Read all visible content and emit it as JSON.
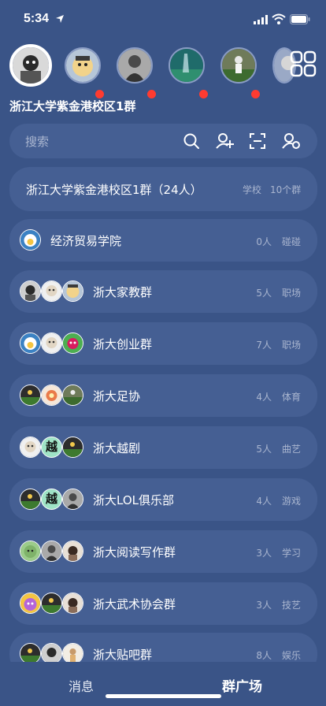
{
  "status": {
    "time": "5:34"
  },
  "group_name": "浙江大学紫金港校区1群",
  "search": {
    "placeholder": "搜索"
  },
  "hero": {
    "title": "浙江大学紫金港校区1群（24人）",
    "tag1": "学校",
    "tag2": "10个群"
  },
  "groups": [
    {
      "name": "经济贸易学院",
      "count": "0人",
      "category": "碰碰"
    },
    {
      "name": "浙大家教群",
      "count": "5人",
      "category": "职场"
    },
    {
      "name": "浙大创业群",
      "count": "7人",
      "category": "职场"
    },
    {
      "name": "浙大足协",
      "count": "4人",
      "category": "体育"
    },
    {
      "name": "浙大越剧",
      "count": "5人",
      "category": "曲艺"
    },
    {
      "name": "浙大LOL俱乐部",
      "count": "4人",
      "category": "游戏"
    },
    {
      "name": "浙大阅读写作群",
      "count": "3人",
      "category": "学习"
    },
    {
      "name": "浙大武术协会群",
      "count": "3人",
      "category": "技艺"
    },
    {
      "name": "浙大贴吧群",
      "count": "8人",
      "category": "娱乐"
    }
  ],
  "avatar_glyph": "越",
  "tabs": {
    "messages": "消息",
    "square": "群广场"
  },
  "colors": {
    "background": "#3a5487",
    "card": "#455f93",
    "badge": "#ff3b30",
    "muted_text": "#a9b5cf"
  }
}
